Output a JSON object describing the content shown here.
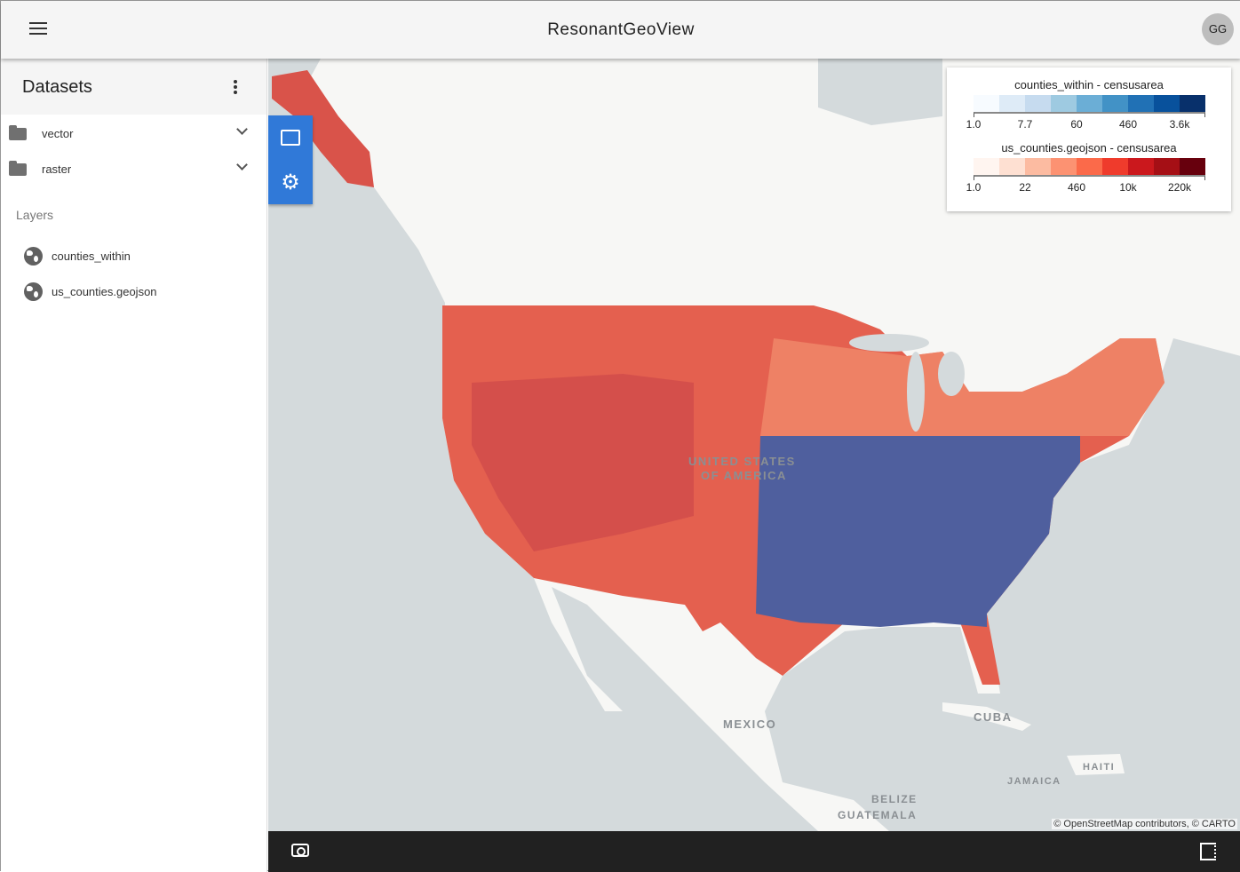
{
  "app": {
    "title": "ResonantGeoView",
    "user_initials": "GG"
  },
  "sidebar": {
    "title": "Datasets",
    "folders": [
      {
        "label": "vector"
      },
      {
        "label": "raster"
      }
    ],
    "layers_heading": "Layers",
    "layers": [
      {
        "label": "counties_within",
        "icon": "globe-icon"
      },
      {
        "label": "us_counties.geojson",
        "icon": "globe-icon"
      }
    ]
  },
  "map": {
    "labels": {
      "usa1": "UNITED STATES",
      "usa2": "OF AMERICA",
      "mexico": "MEXICO",
      "cuba": "CUBA",
      "haiti": "HAITI",
      "jamaica": "JAMAICA",
      "belize": "BELIZE",
      "guatemala": "GUATEMALA"
    },
    "attribution": "© OpenStreetMap contributors, © CARTO",
    "legend": [
      {
        "title": "counties_within - censusarea",
        "colors": [
          "#f7fbff",
          "#deebf7",
          "#c6dbef",
          "#9ecae1",
          "#6baed6",
          "#4292c6",
          "#2171b5",
          "#08519c",
          "#08306b"
        ],
        "ticks": [
          "1.0",
          "7.7",
          "60",
          "460",
          "3.6k"
        ]
      },
      {
        "title": "us_counties.geojson - censusarea",
        "colors": [
          "#fff5f0",
          "#fee0d2",
          "#fcbba1",
          "#fc9272",
          "#fb6a4a",
          "#ef3b2c",
          "#cb181d",
          "#a50f15",
          "#67000d"
        ],
        "ticks": [
          "1.0",
          "22",
          "460",
          "10k",
          "220k"
        ]
      }
    ]
  },
  "colors": {
    "accent": "#3079d8",
    "red_layer": "#e2574c",
    "blue_layer": "#4f5f9e"
  }
}
